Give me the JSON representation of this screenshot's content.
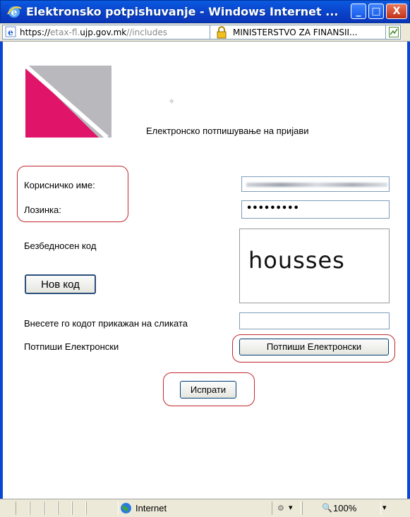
{
  "window": {
    "title": "Elektronsko potpishuvanje - Windows Internet ...",
    "minimize_glyph": "_",
    "maximize_glyph": "□",
    "close_glyph": "X"
  },
  "address": {
    "url_scheme": "https://",
    "url_subdomain": "etax-fl.",
    "url_domain": "ujp.gov.mk",
    "url_path": "//includes",
    "security_text": "MINISTERSTVO ZA FINANSII..."
  },
  "page": {
    "heading": "Електронско потпишување на пријави",
    "username_label": "Корисничко име:",
    "password_label": "Лозинка:",
    "password_value": "•••••••••",
    "security_code_label": "Безбедносен код",
    "captcha_text": "housses",
    "new_code_button": "Нов код",
    "enter_code_label": "Внесете го кодот прикажан на сликата",
    "sign_label": "Потпиши Електронски",
    "sign_button": "Потпиши Електронски",
    "submit_button": "Испрати"
  },
  "status": {
    "zone": "Internet",
    "zoom": "100%",
    "dropdown_glyph": "▾"
  },
  "colors": {
    "titlebar": "#0a46d6",
    "highlight_oval": "#c0282d",
    "logo_pink": "#e0156a",
    "logo_gray": "#b9b9bd"
  }
}
